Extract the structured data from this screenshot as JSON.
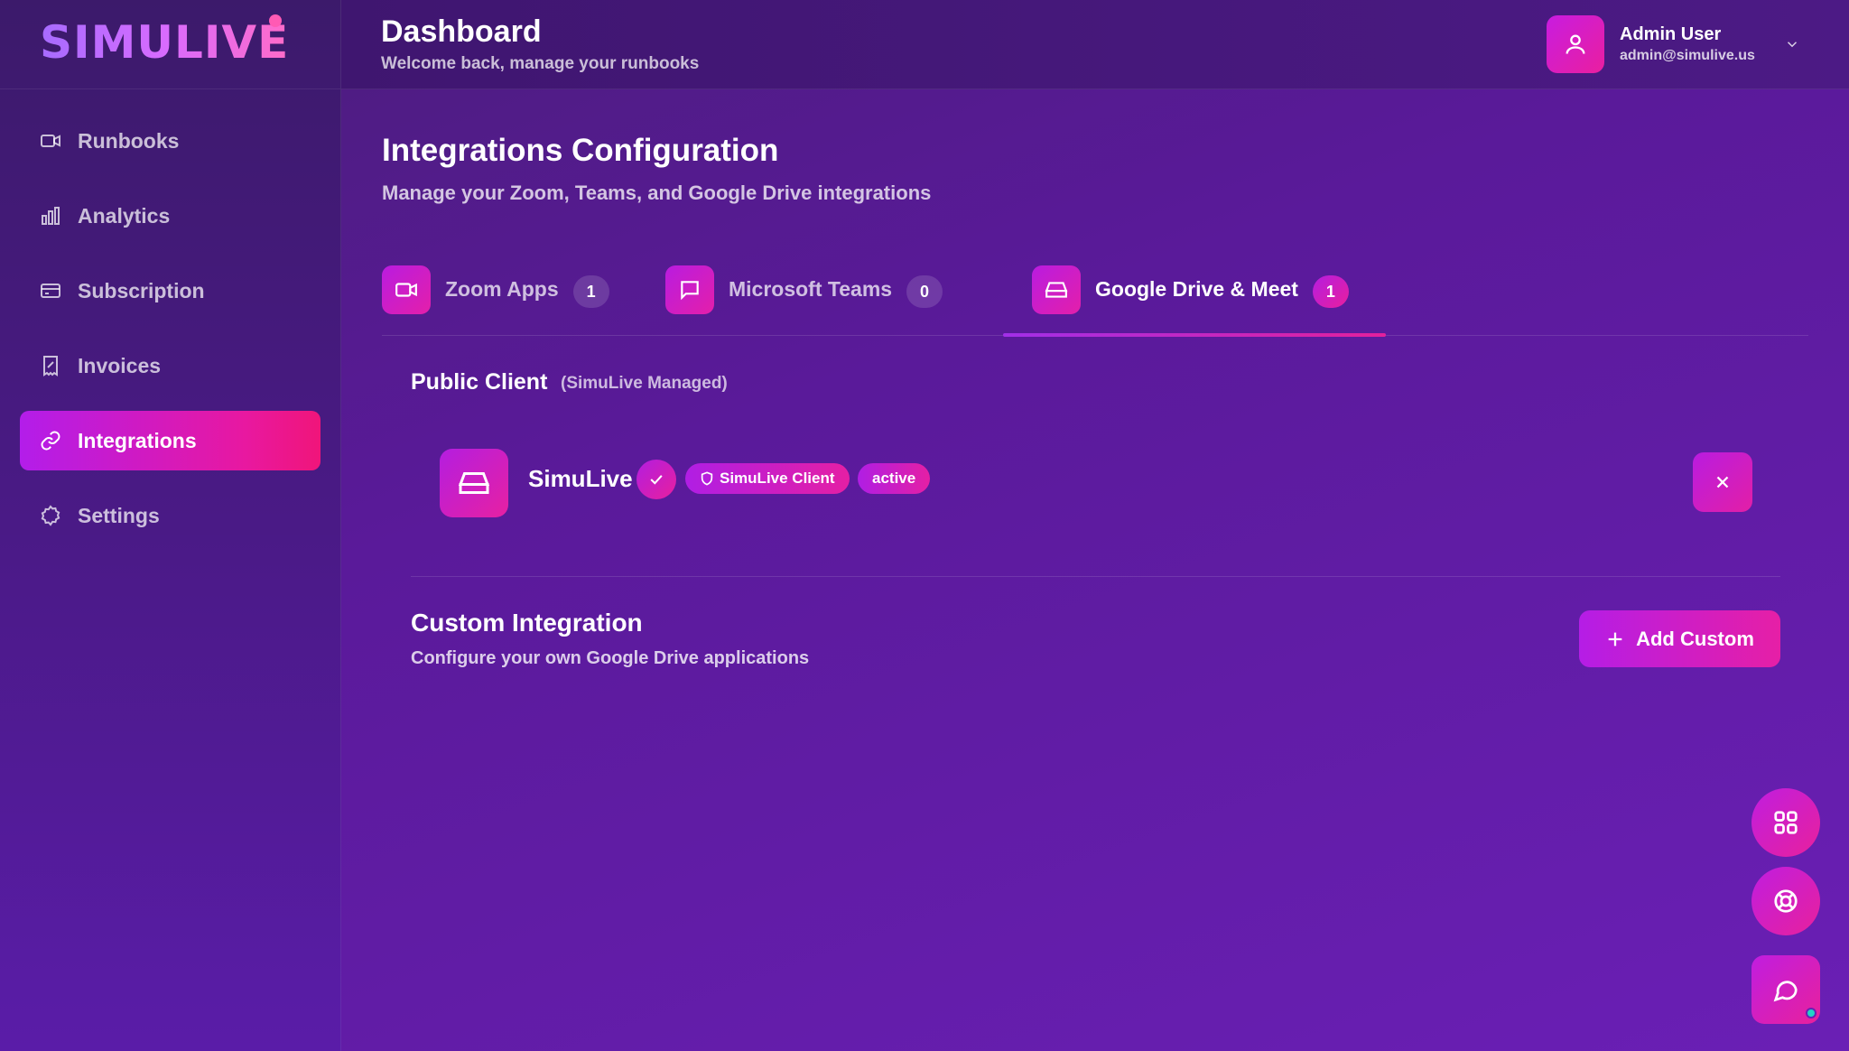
{
  "brand": {
    "logo_text": "SIMULIVE"
  },
  "sidebar": {
    "items": [
      {
        "label": "Runbooks",
        "icon": "video-icon"
      },
      {
        "label": "Analytics",
        "icon": "bar-chart-icon"
      },
      {
        "label": "Subscription",
        "icon": "credit-card-icon"
      },
      {
        "label": "Invoices",
        "icon": "receipt-icon"
      },
      {
        "label": "Integrations",
        "icon": "link-icon",
        "active": true
      },
      {
        "label": "Settings",
        "icon": "gear-icon"
      }
    ]
  },
  "header": {
    "title": "Dashboard",
    "subtitle": "Welcome back, manage your runbooks",
    "user": {
      "name": "Admin User",
      "email": "admin@simulive.us"
    }
  },
  "page": {
    "title": "Integrations Configuration",
    "subtitle": "Manage your Zoom, Teams, and Google Drive integrations"
  },
  "tabs": [
    {
      "label": "Zoom Apps",
      "count": "1",
      "icon": "video-icon"
    },
    {
      "label": "Microsoft Teams",
      "count": "0",
      "icon": "message-square-icon"
    },
    {
      "label": "Google Drive & Meet",
      "count": "1",
      "icon": "hard-drive-icon",
      "active": true
    }
  ],
  "public_client": {
    "title": "Public Client",
    "note": "(SimuLive Managed)",
    "client": {
      "name": "SimuLive",
      "badge_type": "SimuLive Client",
      "badge_status": "active"
    }
  },
  "custom": {
    "title": "Custom Integration",
    "subtitle": "Configure your own Google Drive applications",
    "add_label": "Add Custom"
  },
  "colors": {
    "accent_start": "#b51de6",
    "accent_end": "#e61fa6",
    "background": "#5a1a9a",
    "online": "#22d3c5"
  }
}
